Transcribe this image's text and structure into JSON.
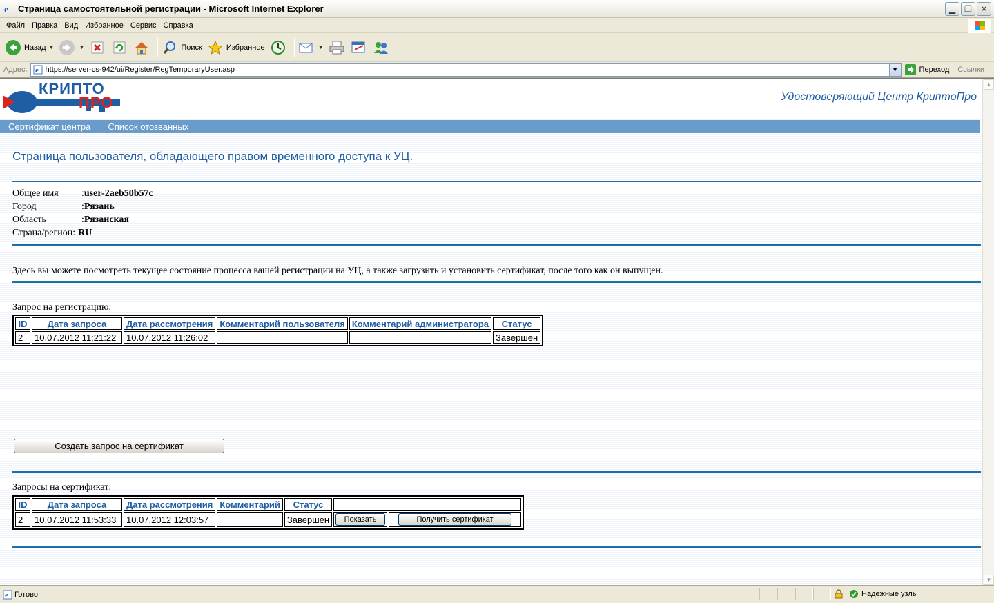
{
  "window": {
    "title": "Страница самостоятельной регистрации - Microsoft Internet Explorer"
  },
  "menu": [
    "Файл",
    "Правка",
    "Вид",
    "Избранное",
    "Сервис",
    "Справка"
  ],
  "toolbar": {
    "back_label": "Назад",
    "search_label": "Поиск",
    "favorites_label": "Избранное"
  },
  "address": {
    "label": "Адрес:",
    "url": "https://server-cs-942/ui/Register/RegTemporaryUser.asp",
    "go_label": "Переход",
    "links_label": "Ссылки"
  },
  "site": {
    "logo_top": "КРИПТО",
    "logo_bottom": "ПРО",
    "title": "Удостоверяющий Центр КриптоПро"
  },
  "nav": [
    "Сертификат центра",
    "Список отозванных"
  ],
  "page": {
    "heading": "Страница пользователя, обладающего правом временного доступа к УЦ.",
    "info": [
      {
        "label": "Общее имя",
        "sep": ":",
        "value": "user-2aeb50b57c"
      },
      {
        "label": "Город",
        "sep": ":",
        "value": "Рязань"
      },
      {
        "label": "Область",
        "sep": ":",
        "value": "Рязанская"
      },
      {
        "label": "Страна/регион:",
        "sep": "",
        "value": "RU"
      }
    ],
    "description": "Здесь вы можете посмотреть текущее состояние процесса вашей регистрации на УЦ, а также загрузить и установить сертификат, после того как он выпущен.",
    "registration": {
      "label": "Запрос на регистрацию:",
      "headers": [
        "ID",
        "Дата запроса",
        "Дата рассмотрения",
        "Комментарий пользователя",
        "Комментарий администратора",
        "Статус"
      ],
      "rows": [
        [
          "2",
          "10.07.2012 11:21:22",
          "10.07.2012 11:26:02",
          "",
          "",
          "Завершен"
        ]
      ]
    },
    "create_request_button": "Создать запрос на сертификат",
    "certificates": {
      "label": "Запросы на сертификат:",
      "headers": [
        "ID",
        "Дата запроса",
        "Дата рассмотрения",
        "Комментарий",
        "Статус",
        ""
      ],
      "rows": [
        [
          "2",
          "10.07.2012 11:53:33",
          "10.07.2012 12:03:57",
          "",
          "Завершен"
        ]
      ],
      "show_button": "Показать",
      "get_button": "Получить сертификат"
    }
  },
  "status": {
    "ready": "Готово",
    "zone": "Надежные узлы"
  }
}
